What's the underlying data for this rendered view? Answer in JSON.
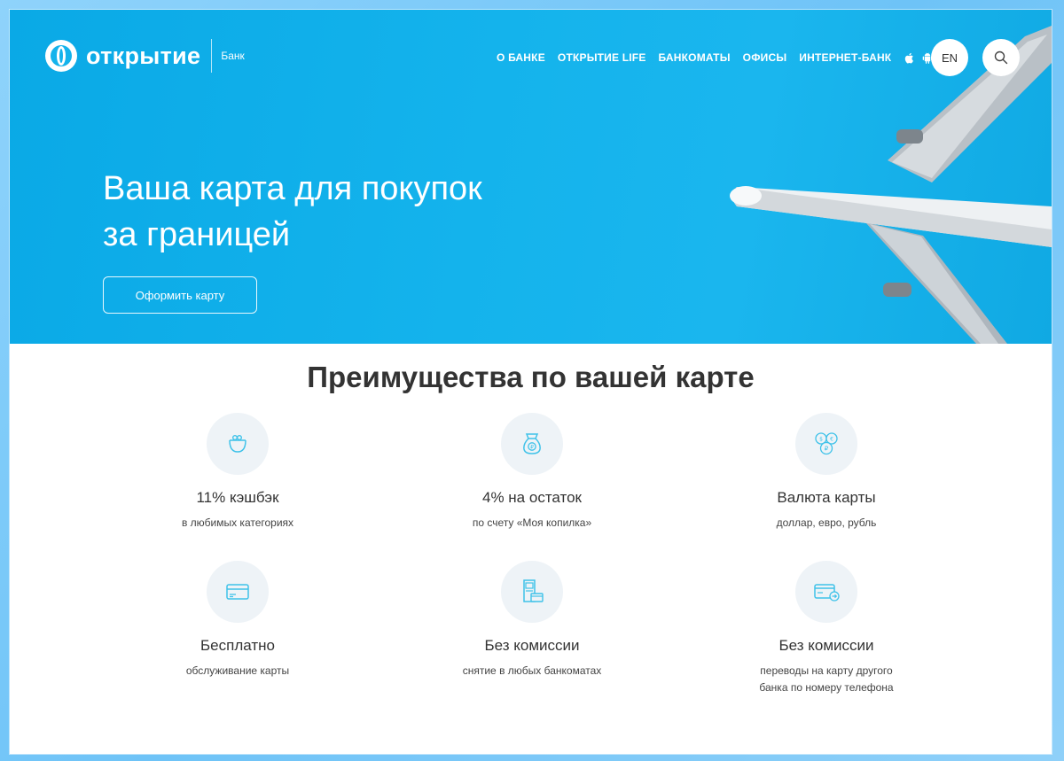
{
  "header": {
    "logo_text": "открытие",
    "logo_sub": "Банк",
    "nav": [
      "О БАНКЕ",
      "ОТКРЫТИЕ LIFE",
      "БАНКОМАТЫ",
      "ОФИСЫ",
      "ИНТЕРНЕТ-БАНК"
    ],
    "lang_button": "EN",
    "icons": [
      "apple-icon",
      "android-icon",
      "search-icon"
    ]
  },
  "hero": {
    "title_line1": "Ваша карта для покупок",
    "title_line2": "за границей",
    "cta_label": "Оформить карту"
  },
  "benefits": {
    "title": "Преимущества по вашей карте",
    "items": [
      {
        "icon": "wallet-icon",
        "title": "11% кэшбэк",
        "subtitle": "в любимых категориях"
      },
      {
        "icon": "money-bag-icon",
        "title": "4% на остаток",
        "subtitle": "по счету «Моя копилка»"
      },
      {
        "icon": "currency-coins-icon",
        "title": "Валюта карты",
        "subtitle": "доллар, евро, рубль"
      },
      {
        "icon": "card-icon",
        "title": "Бесплатно",
        "subtitle": "обслуживание карты"
      },
      {
        "icon": "atm-icon",
        "title": "Без комиссии",
        "subtitle": "снятие в любых банкоматах"
      },
      {
        "icon": "card-transfer-icon",
        "title": "Без комиссии",
        "subtitle_line1": "переводы на карту другого",
        "subtitle_line2": "банка по номеру телефона"
      }
    ]
  },
  "colors": {
    "accent": "#00b0e8",
    "hero_bg": "#14b3ec",
    "icon_stroke": "#3fc2e9",
    "text_dark": "#333333"
  }
}
